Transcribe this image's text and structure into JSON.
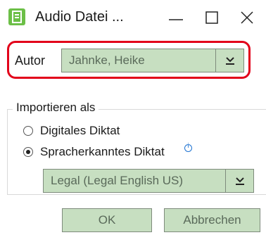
{
  "window": {
    "title": "Audio Datei ...",
    "icon": "document-icon",
    "accent": "#6cbf47"
  },
  "author": {
    "label": "Autor",
    "value": "Jahnke, Heike"
  },
  "import": {
    "group_title": "Importieren als",
    "option_1": "Digitales Diktat",
    "option_2": "Spracherkanntes Diktat",
    "selected": "option_2",
    "language_value": "Legal (Legal English US)"
  },
  "buttons": {
    "ok": "OK",
    "cancel": "Abbrechen"
  },
  "colors": {
    "control_fill": "#c7dfc1",
    "highlight": "#e2001a",
    "info": "#1e73d2"
  }
}
